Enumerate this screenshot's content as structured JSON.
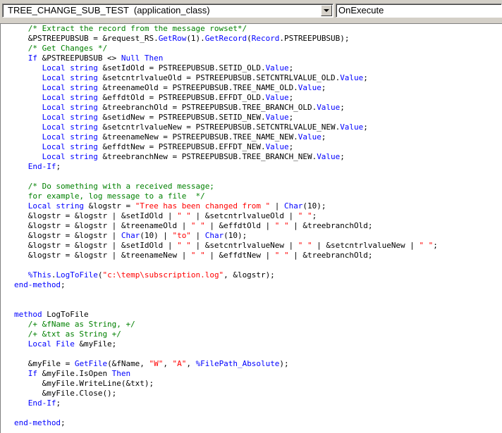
{
  "toolbar": {
    "object_combo": {
      "value": "TREE_CHANGE_SUB_TEST  (application_class)",
      "dropdown_icon": "chevron-down-icon"
    },
    "event_combo": {
      "value": "OnExecute"
    }
  },
  "colors": {
    "keyword": "#0000ff",
    "comment": "#008000",
    "string": "#ff0000",
    "text": "#000000"
  },
  "code_lines": [
    [
      [
        "cm",
        "   /* Extract the record from the message rowset*/"
      ]
    ],
    [
      [
        "tx",
        "   &PSTREEPUBSUB = &request_RS."
      ],
      [
        "kw",
        "GetRow"
      ],
      [
        "tx",
        "(1)."
      ],
      [
        "kw",
        "GetRecord"
      ],
      [
        "tx",
        "("
      ],
      [
        "kw",
        "Record"
      ],
      [
        "tx",
        ".PSTREEPUBSUB);"
      ]
    ],
    [
      [
        "cm",
        "   /* Get Changes */"
      ]
    ],
    [
      [
        "kw",
        "   If"
      ],
      [
        "tx",
        " &PSTREEPUBSUB <> "
      ],
      [
        "kw",
        "Null Then"
      ]
    ],
    [
      [
        "kw",
        "      Local string"
      ],
      [
        "tx",
        " &setIdOld = PSTREEPUBSUB.SETID_OLD."
      ],
      [
        "kw",
        "Value"
      ],
      [
        "tx",
        ";"
      ]
    ],
    [
      [
        "kw",
        "      Local string"
      ],
      [
        "tx",
        " &setcntrlvalueOld = PSTREEPUBSUB.SETCNTRLVALUE_OLD."
      ],
      [
        "kw",
        "Value"
      ],
      [
        "tx",
        ";"
      ]
    ],
    [
      [
        "kw",
        "      Local string"
      ],
      [
        "tx",
        " &treenameOld = PSTREEPUBSUB.TREE_NAME_OLD."
      ],
      [
        "kw",
        "Value"
      ],
      [
        "tx",
        ";"
      ]
    ],
    [
      [
        "kw",
        "      Local string"
      ],
      [
        "tx",
        " &effdtOld = PSTREEPUBSUB.EFFDT_OLD."
      ],
      [
        "kw",
        "Value"
      ],
      [
        "tx",
        ";"
      ]
    ],
    [
      [
        "kw",
        "      Local string"
      ],
      [
        "tx",
        " &treebranchOld = PSTREEPUBSUB.TREE_BRANCH_OLD."
      ],
      [
        "kw",
        "Value"
      ],
      [
        "tx",
        ";"
      ]
    ],
    [
      [
        "kw",
        "      Local string"
      ],
      [
        "tx",
        " &setidNew = PSTREEPUBSUB.SETID_NEW."
      ],
      [
        "kw",
        "Value"
      ],
      [
        "tx",
        ";"
      ]
    ],
    [
      [
        "kw",
        "      Local string"
      ],
      [
        "tx",
        " &setcntrlvalueNew = PSTREEPUBSUB.SETCNTRLVALUE_NEW."
      ],
      [
        "kw",
        "Value"
      ],
      [
        "tx",
        ";"
      ]
    ],
    [
      [
        "kw",
        "      Local string"
      ],
      [
        "tx",
        " &treenameNew = PSTREEPUBSUB.TREE_NAME_NEW."
      ],
      [
        "kw",
        "Value"
      ],
      [
        "tx",
        ";"
      ]
    ],
    [
      [
        "kw",
        "      Local string"
      ],
      [
        "tx",
        " &effdtNew = PSTREEPUBSUB.EFFDT_NEW."
      ],
      [
        "kw",
        "Value"
      ],
      [
        "tx",
        ";"
      ]
    ],
    [
      [
        "kw",
        "      Local string"
      ],
      [
        "tx",
        " &treebranchNew = PSTREEPUBSUB.TREE_BRANCH_NEW."
      ],
      [
        "kw",
        "Value"
      ],
      [
        "tx",
        ";"
      ]
    ],
    [
      [
        "kw",
        "   End-If"
      ],
      [
        "tx",
        ";"
      ]
    ],
    [
      [
        "tx",
        ""
      ]
    ],
    [
      [
        "cm",
        "   /* Do something with a received message;"
      ]
    ],
    [
      [
        "cm",
        "   for example, log message to a file  */"
      ]
    ],
    [
      [
        "kw",
        "   Local string"
      ],
      [
        "tx",
        " &logstr = "
      ],
      [
        "st",
        "\"Tree has been changed from \""
      ],
      [
        "tx",
        " | "
      ],
      [
        "kw",
        "Char"
      ],
      [
        "tx",
        "(10);"
      ]
    ],
    [
      [
        "tx",
        "   &logstr = &logstr | &setIdOld | "
      ],
      [
        "st",
        "\" \""
      ],
      [
        "tx",
        " | &setcntrlvalueOld | "
      ],
      [
        "st",
        "\" \""
      ],
      [
        "tx",
        ";"
      ]
    ],
    [
      [
        "tx",
        "   &logstr = &logstr | &treenameOld | "
      ],
      [
        "st",
        "\" \""
      ],
      [
        "tx",
        " | &effdtOld | "
      ],
      [
        "st",
        "\" \""
      ],
      [
        "tx",
        " | &treebranchOld;"
      ]
    ],
    [
      [
        "tx",
        "   &logstr = &logstr | "
      ],
      [
        "kw",
        "Char"
      ],
      [
        "tx",
        "(10) | "
      ],
      [
        "st",
        "\"to\""
      ],
      [
        "tx",
        " | "
      ],
      [
        "kw",
        "Char"
      ],
      [
        "tx",
        "(10);"
      ]
    ],
    [
      [
        "tx",
        "   &logstr = &logstr | &setIdOld | "
      ],
      [
        "st",
        "\" \""
      ],
      [
        "tx",
        " | &setcntrlvalueNew | "
      ],
      [
        "st",
        "\" \""
      ],
      [
        "tx",
        " | &setcntrlvalueNew | "
      ],
      [
        "st",
        "\" \""
      ],
      [
        "tx",
        ";"
      ]
    ],
    [
      [
        "tx",
        "   &logstr = &logstr | &treenameNew | "
      ],
      [
        "st",
        "\" \""
      ],
      [
        "tx",
        " | &effdtNew | "
      ],
      [
        "st",
        "\" \""
      ],
      [
        "tx",
        " | &treebranchOld;"
      ]
    ],
    [
      [
        "tx",
        ""
      ]
    ],
    [
      [
        "kw",
        "   %This"
      ],
      [
        "tx",
        "."
      ],
      [
        "kw",
        "LogToFile"
      ],
      [
        "tx",
        "("
      ],
      [
        "st",
        "\"c:\\temp\\subscription.log\""
      ],
      [
        "tx",
        ", &logstr);"
      ]
    ],
    [
      [
        "kw",
        "end-method"
      ],
      [
        "tx",
        ";"
      ]
    ],
    [
      [
        "tx",
        ""
      ]
    ],
    [
      [
        "tx",
        ""
      ]
    ],
    [
      [
        "kw",
        "method"
      ],
      [
        "tx",
        " LogToFile"
      ]
    ],
    [
      [
        "cm",
        "   /+ &fName as String, +/"
      ]
    ],
    [
      [
        "cm",
        "   /+ &txt as String +/"
      ]
    ],
    [
      [
        "kw",
        "   Local File"
      ],
      [
        "tx",
        " &myFile;"
      ]
    ],
    [
      [
        "tx",
        ""
      ]
    ],
    [
      [
        "tx",
        "   &myFile = "
      ],
      [
        "kw",
        "GetFile"
      ],
      [
        "tx",
        "(&fName, "
      ],
      [
        "st",
        "\"W\""
      ],
      [
        "tx",
        ", "
      ],
      [
        "st",
        "\"A\""
      ],
      [
        "tx",
        ", "
      ],
      [
        "kw",
        "%FilePath_Absolute"
      ],
      [
        "tx",
        ");"
      ]
    ],
    [
      [
        "kw",
        "   If"
      ],
      [
        "tx",
        " &myFile.IsOpen "
      ],
      [
        "kw",
        "Then"
      ]
    ],
    [
      [
        "tx",
        "      &myFile.WriteLine(&txt);"
      ]
    ],
    [
      [
        "tx",
        "      &myFile.Close();"
      ]
    ],
    [
      [
        "kw",
        "   End-If"
      ],
      [
        "tx",
        ";"
      ]
    ],
    [
      [
        "tx",
        ""
      ]
    ],
    [
      [
        "kw",
        "end-method"
      ],
      [
        "tx",
        ";"
      ]
    ]
  ]
}
